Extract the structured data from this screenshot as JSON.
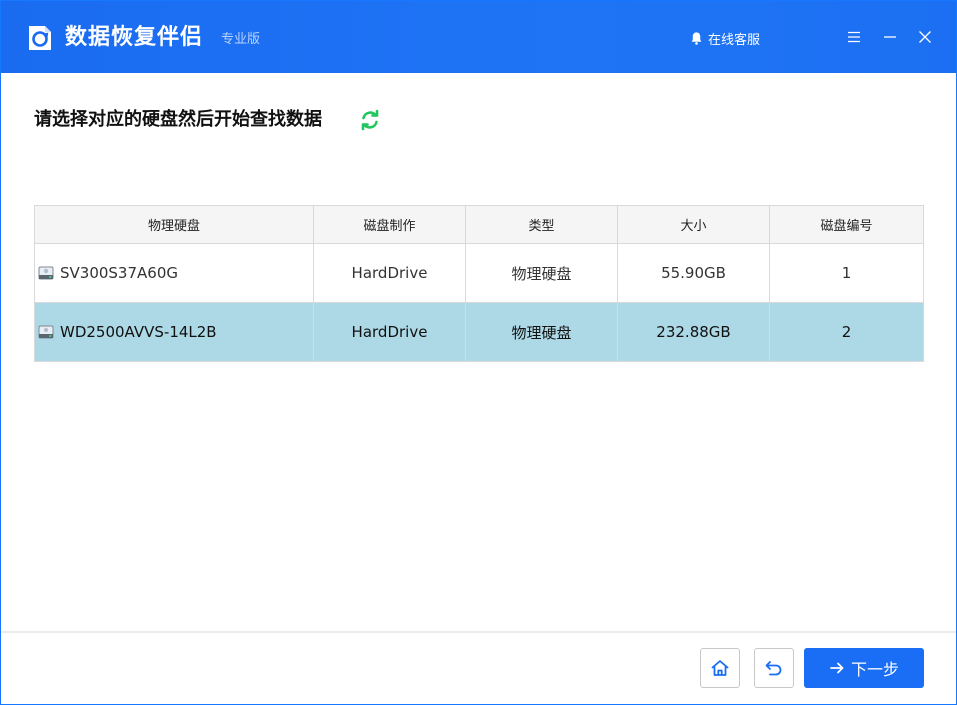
{
  "app": {
    "name": "数据恢复伴侣",
    "edition": "专业版",
    "support_label": "在线客服"
  },
  "main": {
    "heading": "请选择对应的硬盘然后开始查找数据"
  },
  "table": {
    "columns": [
      "物理硬盘",
      "磁盘制作",
      "类型",
      "大小",
      "磁盘编号"
    ],
    "rows": [
      {
        "name": "SV300S37A60G",
        "maker": "HardDrive",
        "type": "物理硬盘",
        "size": "55.90GB",
        "number": "1",
        "selected": false
      },
      {
        "name": "WD2500AVVS-14L2B",
        "maker": "HardDrive",
        "type": "物理硬盘",
        "size": "232.88GB",
        "number": "2",
        "selected": true
      }
    ]
  },
  "footer": {
    "next_label": "下一步"
  },
  "icons": {
    "logo": "app-logo-icon",
    "support": "bell-icon",
    "menu": "hamburger-menu-icon",
    "minimize": "minimize-icon",
    "close": "close-icon",
    "refresh": "refresh-icon",
    "disk": "hard-disk-icon",
    "home": "home-icon",
    "back": "undo-icon",
    "next": "arrow-right-icon"
  },
  "colors": {
    "titlebar": "#1a6bf0",
    "accent": "#1a6ef5",
    "selected_row": "#add8e6",
    "refresh": "#22c55e"
  }
}
